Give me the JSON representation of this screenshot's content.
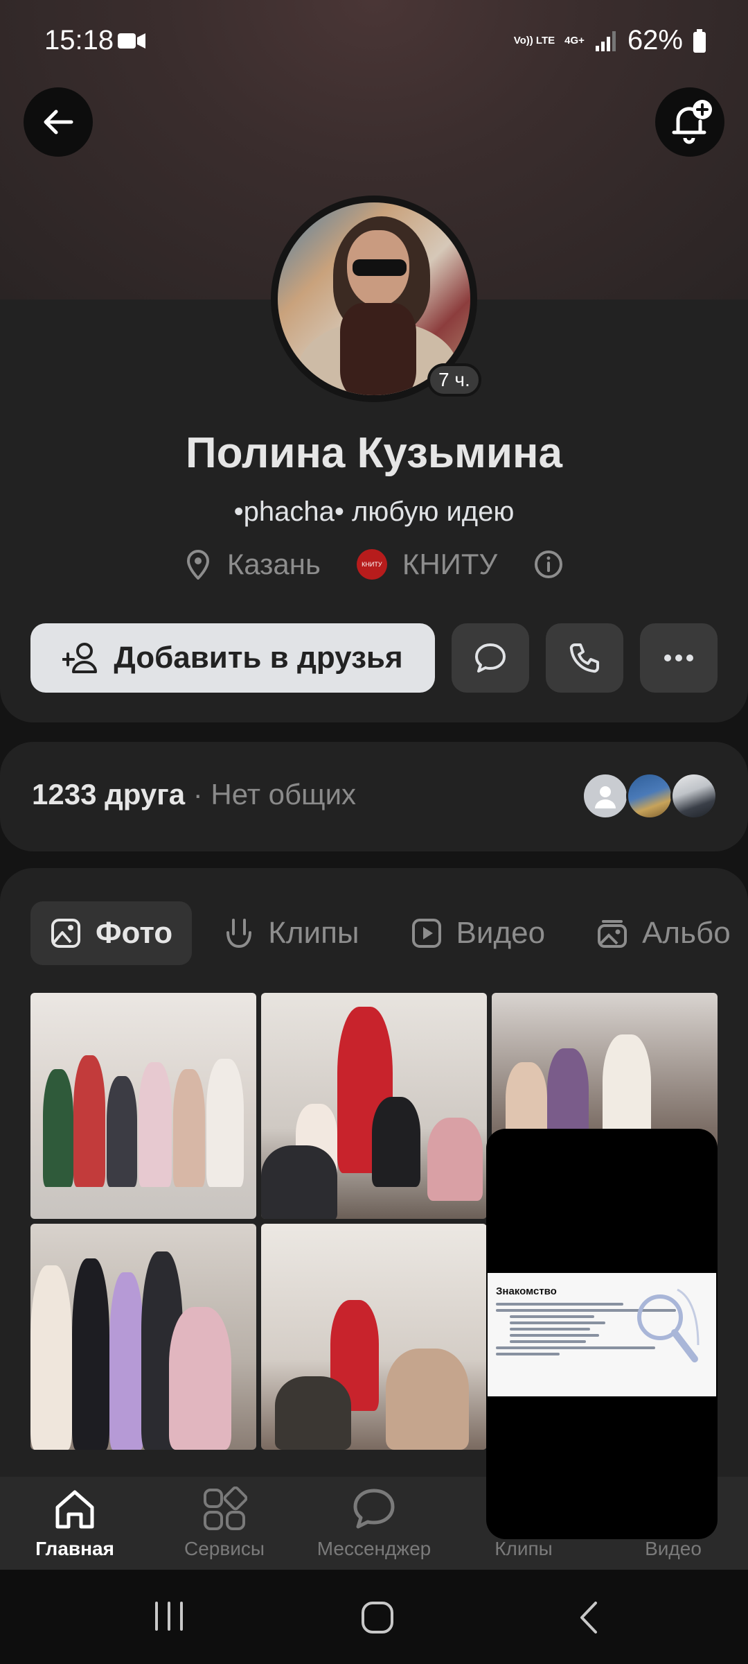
{
  "status_bar": {
    "time": "15:18",
    "net_volte": "Vo)) LTE",
    "net_4g": "4G+",
    "battery": "62%",
    "icons": [
      "video-camera-icon",
      "volte-icon",
      "4g-icon",
      "signal-icon",
      "battery-icon"
    ]
  },
  "header": {
    "back_icon": "arrow-left-icon",
    "notify_icon": "bell-plus-icon"
  },
  "profile": {
    "online_ago": "7 ч.",
    "name": "Полина Кузьмина",
    "status": "•phacha• любую идею",
    "city": "Казань",
    "university_logo": "КНИТУ",
    "university": "КНИТУ",
    "add_friend_label": "Добавить в друзья"
  },
  "friends": {
    "count": "1233 друга",
    "common": " · Нет общих"
  },
  "media_tabs": [
    {
      "label": "Фото",
      "icon": "image-icon",
      "active": true
    },
    {
      "label": "Клипы",
      "icon": "clip-icon",
      "active": false
    },
    {
      "label": "Видео",
      "icon": "play-icon",
      "active": false
    },
    {
      "label": "Альбо",
      "icon": "album-icon",
      "active": false
    }
  ],
  "slide": {
    "title": "Знакомство"
  },
  "bottom_nav": [
    {
      "label": "Главная",
      "icon": "home-icon",
      "active": true
    },
    {
      "label": "Сервисы",
      "icon": "services-icon",
      "active": false
    },
    {
      "label": "Мессенджер",
      "icon": "messenger-icon",
      "active": false
    },
    {
      "label": "Клипы",
      "icon": "clip-icon",
      "active": false
    },
    {
      "label": "Видео",
      "icon": "video-icon",
      "active": false
    }
  ],
  "colors": {
    "background": "#141414",
    "card": "#222222",
    "primary_button": "#e1e3e6",
    "secondary_button": "#3a3a3a",
    "muted_text": "#8d8d8d"
  }
}
